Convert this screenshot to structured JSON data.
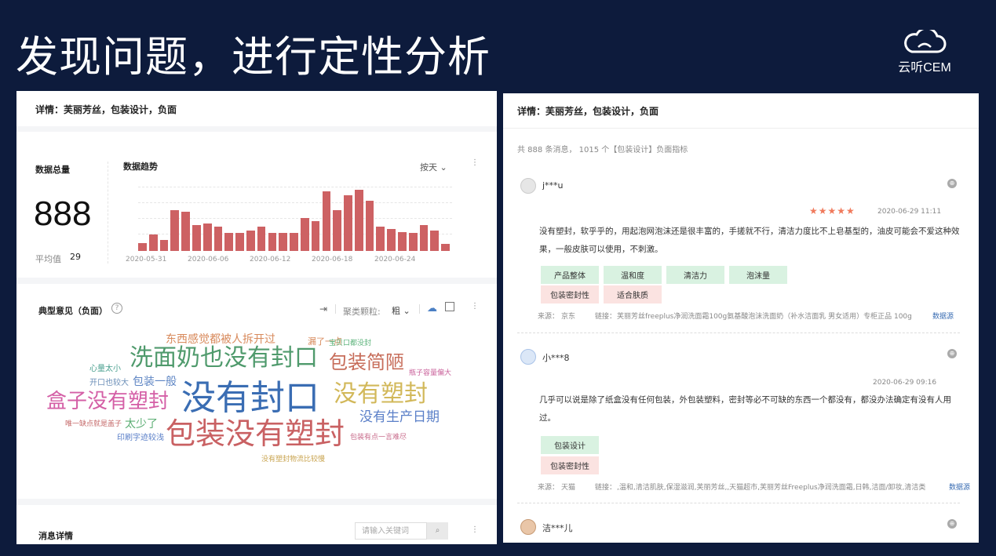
{
  "slide": {
    "title": "发现问题，进行定性分析"
  },
  "brand": {
    "name": "云听CEM"
  },
  "left": {
    "detail_header": "详情：芙丽芳丝，包装设计，负面",
    "total_label": "数据总量",
    "total_value": "888",
    "avg_label": "平均值",
    "avg_value": "29",
    "trend_label": "数据趋势",
    "period_select": "按天",
    "trend_values": [
      6,
      12,
      8,
      30,
      29,
      19,
      20,
      18,
      13,
      13,
      15,
      18,
      13,
      13,
      13,
      24,
      22,
      44,
      30,
      41,
      45,
      37,
      18,
      16,
      14,
      13,
      19,
      15,
      5
    ],
    "trend_max": 45,
    "x_ticks": [
      "2020-05-31",
      "2020-06-06",
      "2020-06-12",
      "2020-06-18",
      "2020-06-24"
    ],
    "opinions_label": "典型意见（负面）",
    "help_icon": "?",
    "granularity_label": "聚类颗粒:",
    "granularity_value": "粗",
    "words": [
      {
        "text": "东西感觉都被人拆开过",
        "color": "#d88a5c",
        "size": 14
      },
      {
        "text": "漏了一点",
        "color": "#d88a5c",
        "size": 11
      },
      {
        "text": "宝贝口都没封",
        "color": "#5bb37a",
        "size": 9
      },
      {
        "text": "心量太小",
        "color": "#4aa08f",
        "size": 10
      },
      {
        "text": "洗面奶也没有封口",
        "color": "#4f9a6c",
        "size": 30
      },
      {
        "text": "包装简陋",
        "color": "#c76d5a",
        "size": 24
      },
      {
        "text": "瓶子容量偏大",
        "color": "#c9609a",
        "size": 9
      },
      {
        "text": "开口也较大",
        "color": "#6c8fb8",
        "size": 10
      },
      {
        "text": "包装一般",
        "color": "#5f86c4",
        "size": 14
      },
      {
        "text": "没有封口",
        "color": "#3a6db3",
        "size": 44
      },
      {
        "text": "没有塑封",
        "color": "#d2b85a",
        "size": 30
      },
      {
        "text": "盒子没有塑封",
        "color": "#d45fa6",
        "size": 26
      },
      {
        "text": "唯一缺点就是盖子",
        "color": "#c56a6a",
        "size": 9
      },
      {
        "text": "太少了",
        "color": "#5cae74",
        "size": 14
      },
      {
        "text": "没有生产日期",
        "color": "#5a7fc8",
        "size": 17
      },
      {
        "text": "印刷字迹较浅",
        "color": "#5a7fc8",
        "size": 10
      },
      {
        "text": "包装没有塑封",
        "color": "#c96163",
        "size": 38
      },
      {
        "text": "包装有点一言难尽",
        "color": "#c96d8c",
        "size": 9
      },
      {
        "text": "没有塑封物流比较慢",
        "color": "#c9a450",
        "size": 9
      }
    ],
    "messages_label": "消息详情",
    "search_placeholder": "请输入关键词"
  },
  "right": {
    "detail_header": "详情：芙丽芳丝，包装设计，负面",
    "summary": "共 888 条消息， 1015 个【包装设计】负面指标",
    "reviews": [
      {
        "user": "j***u",
        "stars": 5,
        "time": "2020-06-29 11:11",
        "text": "没有塑封，软乎乎的，用起泡网泡沫还是很丰富的，手搓就不行，清洁力度比不上皂基型的，油皮可能会不爱这种效果，一般皮肤可以使用，不刺激。",
        "tags_green": [
          "产品整体",
          "温和度",
          "清洁力",
          "泡沫量"
        ],
        "tags_pink": [
          "包装密封性",
          "适合肤质"
        ],
        "source_label": "来源：",
        "source": "京东",
        "link_label": "链接：",
        "link": "芙丽芳丝freeplus净润洗面霜100g氨基酸泡沫洗面奶（补水洁面乳 男女适用）专柜正品 100g",
        "data_link": "数据源"
      },
      {
        "user": "小***8",
        "time": "2020-06-29 09:16",
        "text": "几乎可以说是除了纸盒没有任何包装，外包装塑料，密封等必不可缺的东西一个都没有，都没办法确定有没有人用过。",
        "tags_green": [
          "包装设计"
        ],
        "tags_pink": [
          "包装密封性"
        ],
        "source_label": "来源：",
        "source": "天猫",
        "link_label": "链接：",
        "link": ",温和,清洁肌肤,保湿滋润,芙丽芳丝,,天猫超市,芙丽芳丝Freeplus净润洗面霜,日韩,洁面/卸妆,清洁类",
        "data_link": "数据源"
      },
      {
        "user": "洁***儿"
      }
    ],
    "star_char": "★",
    "globe_char": "⊕"
  }
}
